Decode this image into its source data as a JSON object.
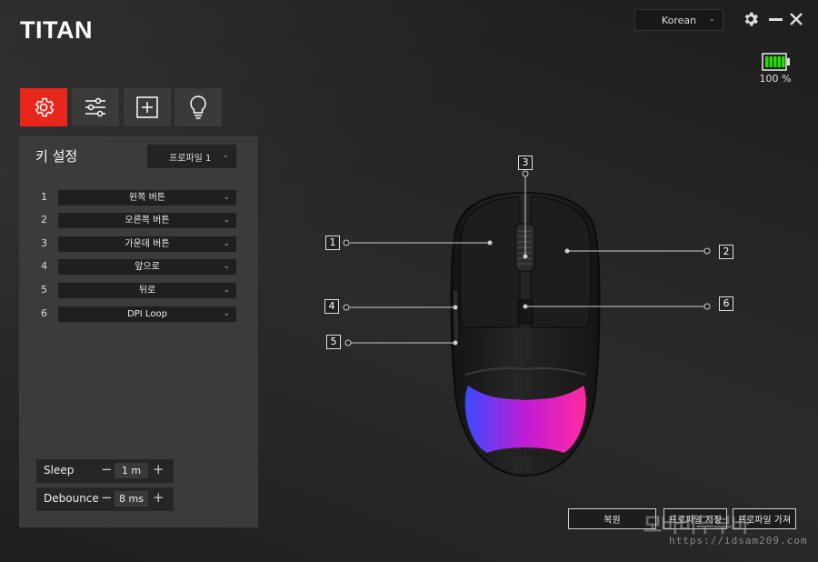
{
  "app": {
    "logo": "TITAN"
  },
  "header": {
    "language": {
      "selected": "Korean"
    },
    "icons": [
      "gear-icon",
      "minimize-icon",
      "close-icon"
    ]
  },
  "battery": {
    "level_percent": 100,
    "label": "100 %"
  },
  "tabs": [
    {
      "icon": "gear-icon",
      "active": true
    },
    {
      "icon": "sliders-icon",
      "active": false
    },
    {
      "icon": "macro-add-icon",
      "active": false
    },
    {
      "icon": "lightbulb-icon",
      "active": false
    }
  ],
  "key_settings": {
    "title": "키 설정",
    "profile": {
      "selected": "프로파일 1"
    },
    "rows": [
      {
        "number": "1",
        "value": "왼쪽 버튼"
      },
      {
        "number": "2",
        "value": "오른쪽 버튼"
      },
      {
        "number": "3",
        "value": "가운데 버튼"
      },
      {
        "number": "4",
        "value": "앞으로"
      },
      {
        "number": "5",
        "value": "뒤로"
      },
      {
        "number": "6",
        "value": "DPI Loop"
      }
    ],
    "sleep": {
      "label": "Sleep",
      "value": "1 m"
    },
    "debounce": {
      "label": "Debounce",
      "value": "8 ms"
    }
  },
  "mouse": {
    "brand": "TITAN",
    "callouts": [
      "1",
      "2",
      "3",
      "4",
      "5",
      "6"
    ],
    "rgb_colors": [
      "#3a4bff",
      "#c21bd6",
      "#ff2ba0"
    ]
  },
  "footer": {
    "restore": "복원",
    "profile_save": "프로파일 저장",
    "profile_load": "프로파일 가져"
  },
  "watermark": {
    "title": "모바비두부바",
    "url": "https://idsam209.com"
  },
  "colors": {
    "accent": "#e8261c",
    "battery": "#22e000"
  }
}
